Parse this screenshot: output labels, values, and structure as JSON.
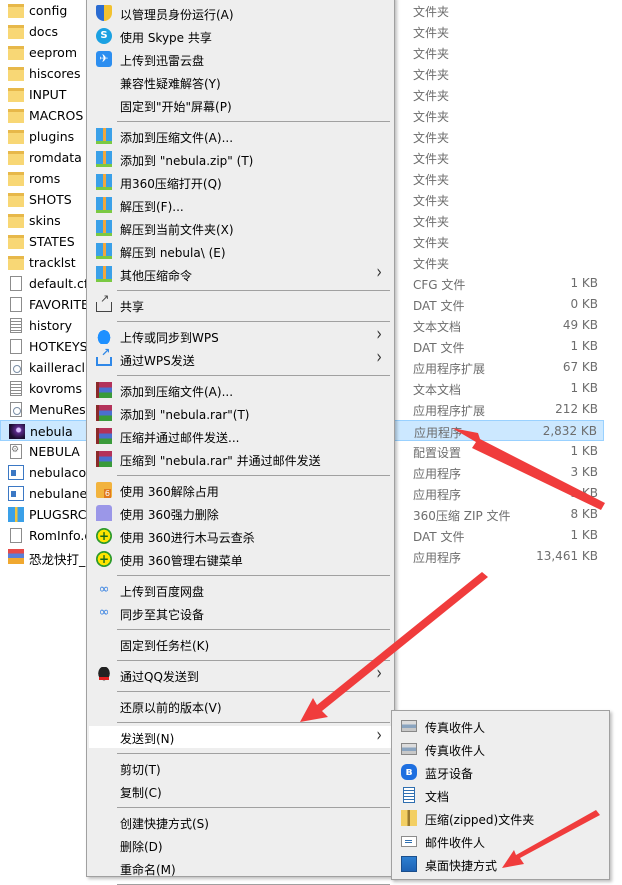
{
  "files": [
    {
      "name": "config",
      "type": "文件夹",
      "size": "",
      "icon": "folder-icon"
    },
    {
      "name": "docs",
      "type": "文件夹",
      "size": "",
      "icon": "folder-icon"
    },
    {
      "name": "eeprom",
      "type": "文件夹",
      "size": "",
      "icon": "folder-icon"
    },
    {
      "name": "hiscores",
      "type": "文件夹",
      "size": "",
      "icon": "folder-icon"
    },
    {
      "name": "INPUT",
      "type": "文件夹",
      "size": "",
      "icon": "folder-icon"
    },
    {
      "name": "MACROS",
      "type": "文件夹",
      "size": "",
      "icon": "folder-icon"
    },
    {
      "name": "plugins",
      "type": "文件夹",
      "size": "",
      "icon": "folder-icon"
    },
    {
      "name": "romdata",
      "type": "文件夹",
      "size": "",
      "icon": "folder-icon"
    },
    {
      "name": "roms",
      "type": "文件夹",
      "size": "",
      "icon": "folder-icon"
    },
    {
      "name": "SHOTS",
      "type": "文件夹",
      "size": "",
      "icon": "folder-icon"
    },
    {
      "name": "skins",
      "type": "文件夹",
      "size": "",
      "icon": "folder-icon"
    },
    {
      "name": "STATES",
      "type": "文件夹",
      "size": "",
      "icon": "folder-icon"
    },
    {
      "name": "tracklst",
      "type": "文件夹",
      "size": "",
      "icon": "folder-icon"
    },
    {
      "name": "default.cfg",
      "type": "CFG 文件",
      "size": "1 KB",
      "icon": "file-icon"
    },
    {
      "name": "FAVORITE",
      "type": "DAT 文件",
      "size": "0 KB",
      "icon": "file-icon"
    },
    {
      "name": "history",
      "type": "文本文档",
      "size": "49 KB",
      "icon": "text-file-icon"
    },
    {
      "name": "HOTKEYS",
      "type": "DAT 文件",
      "size": "1 KB",
      "icon": "file-icon"
    },
    {
      "name": "kailleraclient",
      "type": "应用程序扩展",
      "size": "67 KB",
      "icon": "dll-icon"
    },
    {
      "name": "kovroms",
      "type": "文本文档",
      "size": "1 KB",
      "icon": "text-file-icon"
    },
    {
      "name": "MenuRes.dll",
      "type": "应用程序扩展",
      "size": "212 KB",
      "icon": "dll-icon"
    },
    {
      "name": "nebula",
      "type": "应用程序",
      "size": "2,832 KB",
      "icon": "nebula-exe-icon",
      "selected": true
    },
    {
      "name": "NEBULA",
      "type": "配置设置",
      "size": "1 KB",
      "icon": "config-settings-icon"
    },
    {
      "name": "nebulaconfig",
      "type": "应用程序",
      "size": "3 KB",
      "icon": "app-icon"
    },
    {
      "name": "nebulanet",
      "type": "应用程序",
      "size": "3 KB",
      "icon": "app-icon"
    },
    {
      "name": "PLUGSRC",
      "type": "360压缩 ZIP 文件",
      "size": "8 KB",
      "icon": "zip-archive-icon"
    },
    {
      "name": "RomInfo.dat",
      "type": "DAT 文件",
      "size": "1 KB",
      "icon": "file-icon"
    },
    {
      "name": "恐龙快打_nebula",
      "type": "应用程序",
      "size": "13,461 KB",
      "icon": "game-exe-icon"
    }
  ],
  "context_menu": {
    "items": [
      {
        "label": "以管理员身份运行(A)",
        "icon": "shield-icon"
      },
      {
        "label": "使用 Skype 共享",
        "icon": "skype-icon"
      },
      {
        "label": "上传到迅雷云盘",
        "icon": "xunlei-icon"
      },
      {
        "label": "兼容性疑难解答(Y)",
        "icon": ""
      },
      {
        "label": "固定到\"开始\"屏幕(P)",
        "icon": ""
      },
      {
        "sep": true
      },
      {
        "label": "添加到压缩文件(A)...",
        "icon": "360zip-icon"
      },
      {
        "label": "添加到 \"nebula.zip\" (T)",
        "icon": "360zip-icon"
      },
      {
        "label": "用360压缩打开(Q)",
        "icon": "360zip-icon"
      },
      {
        "label": "解压到(F)...",
        "icon": "360zip-icon"
      },
      {
        "label": "解压到当前文件夹(X)",
        "icon": "360zip-icon"
      },
      {
        "label": "解压到 nebula\\ (E)",
        "icon": "360zip-icon"
      },
      {
        "label": "其他压缩命令",
        "icon": "360zip-icon",
        "submenu": true
      },
      {
        "sep": true
      },
      {
        "label": "共享",
        "icon": "share-icon"
      },
      {
        "sep": true
      },
      {
        "label": "上传或同步到WPS",
        "icon": "wps-cloud-icon",
        "submenu": true
      },
      {
        "label": "通过WPS发送",
        "icon": "wps-send-icon",
        "submenu": true
      },
      {
        "sep": true
      },
      {
        "label": "添加到压缩文件(A)...",
        "icon": "winrar-icon"
      },
      {
        "label": "添加到 \"nebula.rar\"(T)",
        "icon": "winrar-icon"
      },
      {
        "label": "压缩并通过邮件发送...",
        "icon": "winrar-icon"
      },
      {
        "label": "压缩到 \"nebula.rar\" 并通过邮件发送",
        "icon": "winrar-icon"
      },
      {
        "sep": true
      },
      {
        "label": "使用 360解除占用",
        "icon": "360-unlock-icon"
      },
      {
        "label": "使用 360强力删除",
        "icon": "360-shred-icon"
      },
      {
        "label": "使用 360进行木马云查杀",
        "icon": "360-safe-icon"
      },
      {
        "label": "使用 360管理右键菜单",
        "icon": "360-safe-icon"
      },
      {
        "sep": true
      },
      {
        "label": "上传到百度网盘",
        "icon": "baidu-netdisk-icon"
      },
      {
        "label": "同步至其它设备",
        "icon": "baidu-netdisk-icon"
      },
      {
        "sep": true
      },
      {
        "label": "固定到任务栏(K)",
        "icon": ""
      },
      {
        "sep": true
      },
      {
        "label": "通过QQ发送到",
        "icon": "qq-icon",
        "submenu": true
      },
      {
        "sep": true
      },
      {
        "label": "还原以前的版本(V)",
        "icon": ""
      },
      {
        "sep": true
      },
      {
        "label": "发送到(N)",
        "icon": "",
        "submenu": true,
        "active": true
      },
      {
        "sep": true
      },
      {
        "label": "剪切(T)",
        "icon": ""
      },
      {
        "label": "复制(C)",
        "icon": ""
      },
      {
        "sep": true
      },
      {
        "label": "创建快捷方式(S)",
        "icon": ""
      },
      {
        "label": "删除(D)",
        "icon": ""
      },
      {
        "label": "重命名(M)",
        "icon": ""
      },
      {
        "sep": true
      }
    ]
  },
  "send_to_menu": {
    "items": [
      {
        "label": "传真收件人",
        "icon": "fax-icon"
      },
      {
        "label": "传真收件人",
        "icon": "fax-icon"
      },
      {
        "label": "蓝牙设备",
        "icon": "bluetooth-icon"
      },
      {
        "label": "文档",
        "icon": "document-icon"
      },
      {
        "label": "压缩(zipped)文件夹",
        "icon": "zip-folder-icon"
      },
      {
        "label": "邮件收件人",
        "icon": "mail-icon"
      },
      {
        "label": "桌面快捷方式",
        "icon": "desktop-shortcut-icon"
      }
    ]
  },
  "colors": {
    "selection": "#cce8ff",
    "menu_bg": "#eeeeee",
    "annotation_arrow": "#f03c3c"
  }
}
